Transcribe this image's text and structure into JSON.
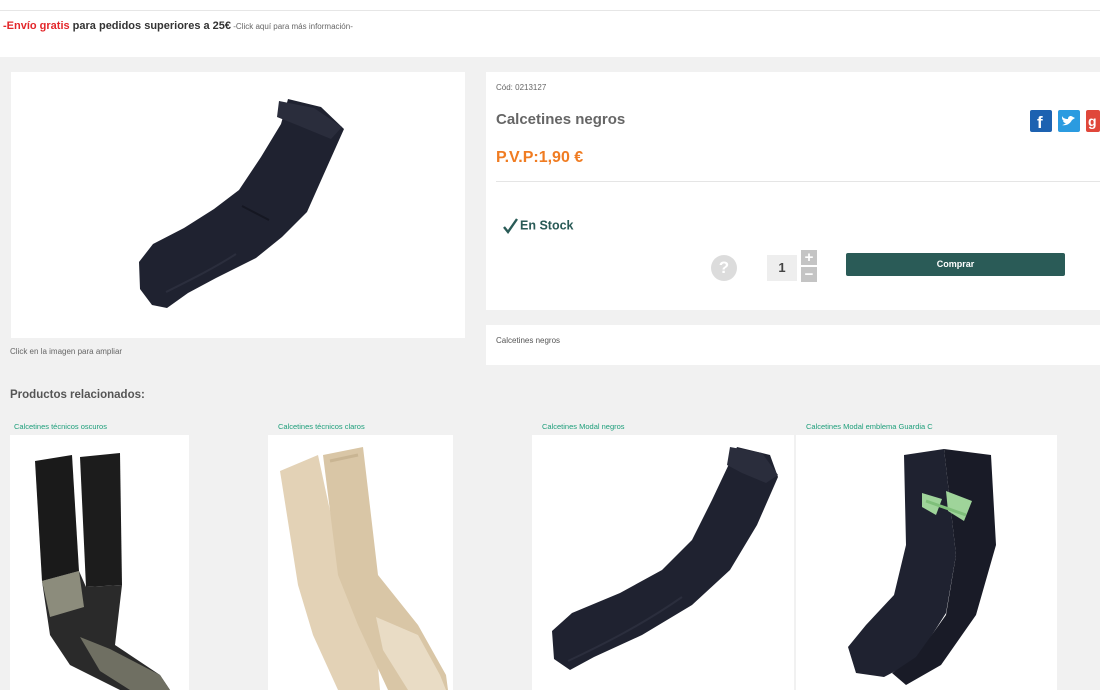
{
  "promo": {
    "highlight": "-Envío gratis",
    "text": " para pedidos superiores a 25€",
    "small": " -Click aquí para más información-"
  },
  "product": {
    "image_alt": "sock-image",
    "image_caption": "Click en la imagen para ampliar",
    "code": "Cód: 0213127",
    "title": "Calcetines negros",
    "price": "P.V.P:1,90 €",
    "stock": "En Stock",
    "help": "?",
    "quantity": "1",
    "plus": "+",
    "minus": "−",
    "buy_label": "Comprar",
    "description": "Calcetines negros"
  },
  "social": {
    "facebook": "f",
    "gplus": "g"
  },
  "colors": {
    "accent": "#2a5b57",
    "price": "#f07c22",
    "promo_red": "#e3262a",
    "link_green": "#1d9e7a"
  },
  "related": {
    "title": "Productos relacionados:",
    "items": [
      {
        "label": "Calcetines técnicos oscuros"
      },
      {
        "label": "Calcetines técnicos claros"
      },
      {
        "label": "Calcetines Modal negros"
      },
      {
        "label": "Calcetines Modal emblema Guardia C"
      }
    ]
  }
}
